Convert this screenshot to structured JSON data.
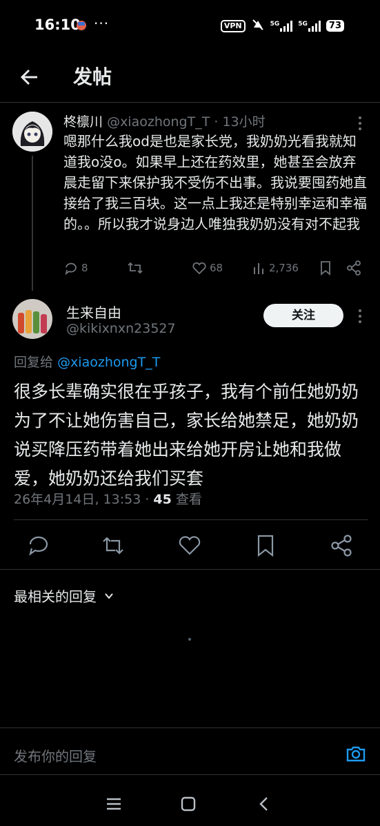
{
  "status": {
    "time": "16:10",
    "dots": "···",
    "vpn": "VPN",
    "net1": "5G",
    "net2": "5G",
    "battery": "73"
  },
  "header": {
    "title": "发帖"
  },
  "parent_post": {
    "name": "柊檩川",
    "handle": "@xiaozhongT_T",
    "sep": "·",
    "time": "13小时",
    "text": "嗯那什么我od是也是家长党，我奶奶光看我就知道我o没o。如果早上还在药效里，她甚至会放弃晨走留下来保护我不受伤不出事。我说要囤药她直接给了我三百块。这一点上我还是特别幸运和幸福的。。所以我才说身边人唯独我奶奶没有对不起我",
    "replies": "8",
    "likes": "68",
    "views": "2,736"
  },
  "main_post": {
    "name": "生来自由",
    "handle": "@kikixnxn23527",
    "follow_label": "关注",
    "reply_prefix": "回复给",
    "reply_mention": "@xiaozhongT_T",
    "text": "很多长辈确实很在乎孩子，我有个前任她奶奶为了不让她伤害自己，家长给她禁足，她奶奶说买降压药带着她出来给她开房让她和我做爱，她奶奶还给我们买套",
    "date": "26年4月14日, 13:53",
    "dot": "·",
    "views": "45",
    "views_label": "查看"
  },
  "replies_sort": {
    "label": "最相关的回复"
  },
  "compose": {
    "placeholder": "发布你的回复"
  },
  "colors": {
    "accent": "#1d9bf0",
    "bg": "#000000",
    "text": "#e7e9ea",
    "muted": "#71767b"
  },
  "icons": [
    "back-arrow-icon",
    "reply-icon",
    "retweet-icon",
    "like-icon",
    "views-icon",
    "bookmark-icon",
    "share-icon",
    "more-icon",
    "chevron-down-icon",
    "camera-icon",
    "menu-icon",
    "home-icon",
    "back-icon"
  ]
}
